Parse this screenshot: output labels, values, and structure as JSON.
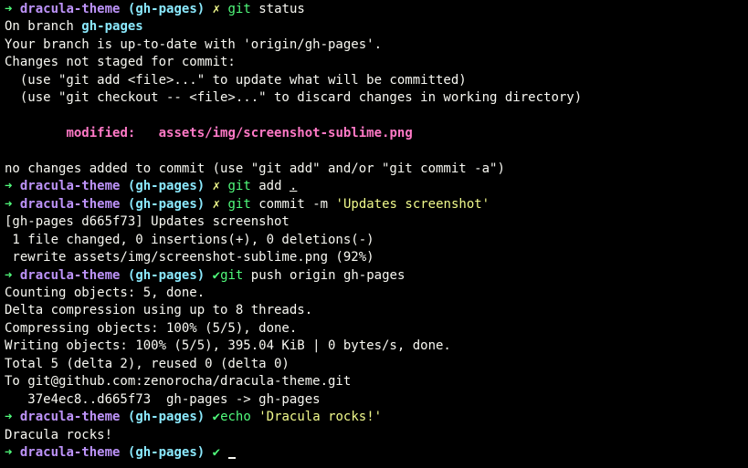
{
  "prompt": {
    "arrow": "➜",
    "dir": "dracula-theme",
    "branch": "(gh-pages)",
    "mark_dirty": "✗",
    "mark_clean": "✔"
  },
  "colors": {
    "background": "#000000",
    "foreground": "#f8f8f2",
    "green": "#50fa7b",
    "purple": "#bd93f9",
    "cyan": "#8be9fd",
    "yellow": "#f1fa8c",
    "pink": "#ff79c6"
  },
  "lines": [
    {
      "cmd": "git",
      "args": "status"
    },
    {
      "prefix": "On branch ",
      "branch": "gh-pages"
    },
    {
      "text": "Your branch is up-to-date with 'origin/gh-pages'."
    },
    {
      "text": "Changes not staged for commit:"
    },
    {
      "text": "  (use \"git add <file>...\" to update what will be committed)"
    },
    {
      "text": "  (use \"git checkout -- <file>...\" to discard changes in working directory)"
    },
    {
      "text": ""
    },
    {
      "indent": "        ",
      "label": "modified:",
      "gap": "   ",
      "file": "assets/img/screenshot-sublime.png"
    },
    {
      "text": ""
    },
    {
      "text": "no changes added to commit (use \"git add\" and/or \"git commit -a\")"
    },
    {
      "cmd": "git",
      "args": "add .",
      "args_main": "add ",
      "args_dot": "."
    },
    {
      "cmd": "git",
      "args_main": "commit -m ",
      "args_str": "'Updates screenshot'"
    },
    {
      "text": "[gh-pages d665f73] Updates screenshot"
    },
    {
      "text": " 1 file changed, 0 insertions(+), 0 deletions(-)"
    },
    {
      "text": " rewrite assets/img/screenshot-sublime.png (92%)"
    },
    {
      "cmd": "git",
      "args": "push origin gh-pages"
    },
    {
      "text": "Counting objects: 5, done."
    },
    {
      "text": "Delta compression using up to 8 threads."
    },
    {
      "text": "Compressing objects: 100% (5/5), done."
    },
    {
      "text": "Writing objects: 100% (5/5), 395.04 KiB | 0 bytes/s, done."
    },
    {
      "text": "Total 5 (delta 2), reused 0 (delta 0)"
    },
    {
      "text": "To git@github.com:zenorocha/dracula-theme.git"
    },
    {
      "text": "   37e4ec8..d665f73  gh-pages -> gh-pages"
    },
    {
      "cmd": "echo",
      "args_str": "'Dracula rocks!'"
    },
    {
      "text": "Dracula rocks!"
    }
  ]
}
